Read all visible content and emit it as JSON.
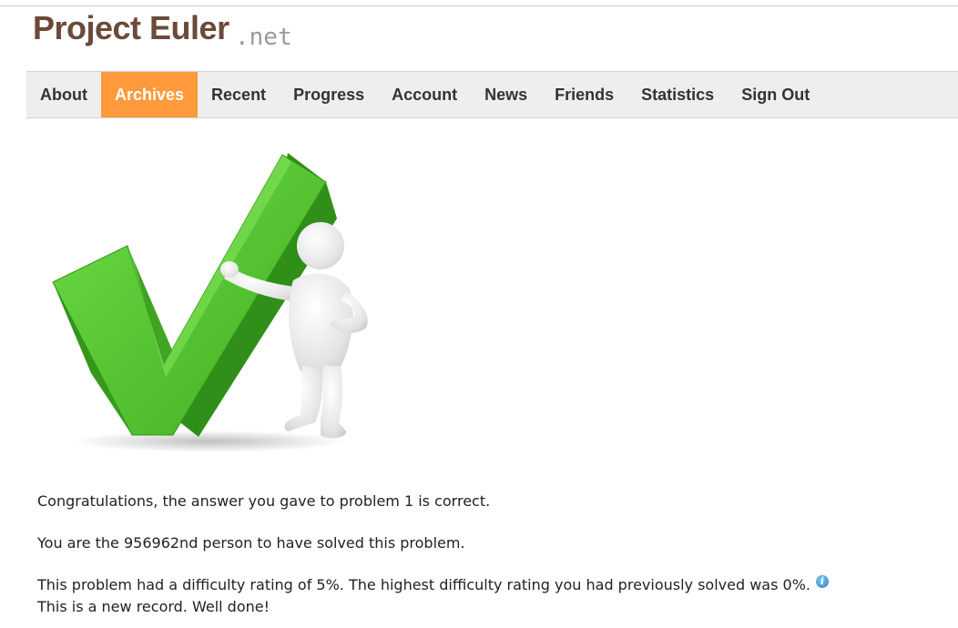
{
  "site": {
    "logo_main": "Project Euler",
    "logo_suffix": ".net"
  },
  "nav": {
    "items": [
      {
        "label": "About",
        "active": false
      },
      {
        "label": "Archives",
        "active": true
      },
      {
        "label": "Recent",
        "active": false
      },
      {
        "label": "Progress",
        "active": false
      },
      {
        "label": "Account",
        "active": false
      },
      {
        "label": "News",
        "active": false
      },
      {
        "label": "Friends",
        "active": false
      },
      {
        "label": "Statistics",
        "active": false
      },
      {
        "label": "Sign Out",
        "active": false
      }
    ],
    "active_color": "#ff9a3c"
  },
  "hero": {
    "icon": "green-checkmark-with-figure",
    "check_color": "#4cbb2c"
  },
  "messages": {
    "correct": "Congratulations, the answer you gave to problem 1 is correct.",
    "rank": "You are the 956962nd person to have solved this problem.",
    "difficulty": "This problem had a difficulty rating of 5%. The highest difficulty rating you had previously solved was 0%.",
    "record": "This is a new record. Well done!",
    "info_icon": "info-icon"
  }
}
